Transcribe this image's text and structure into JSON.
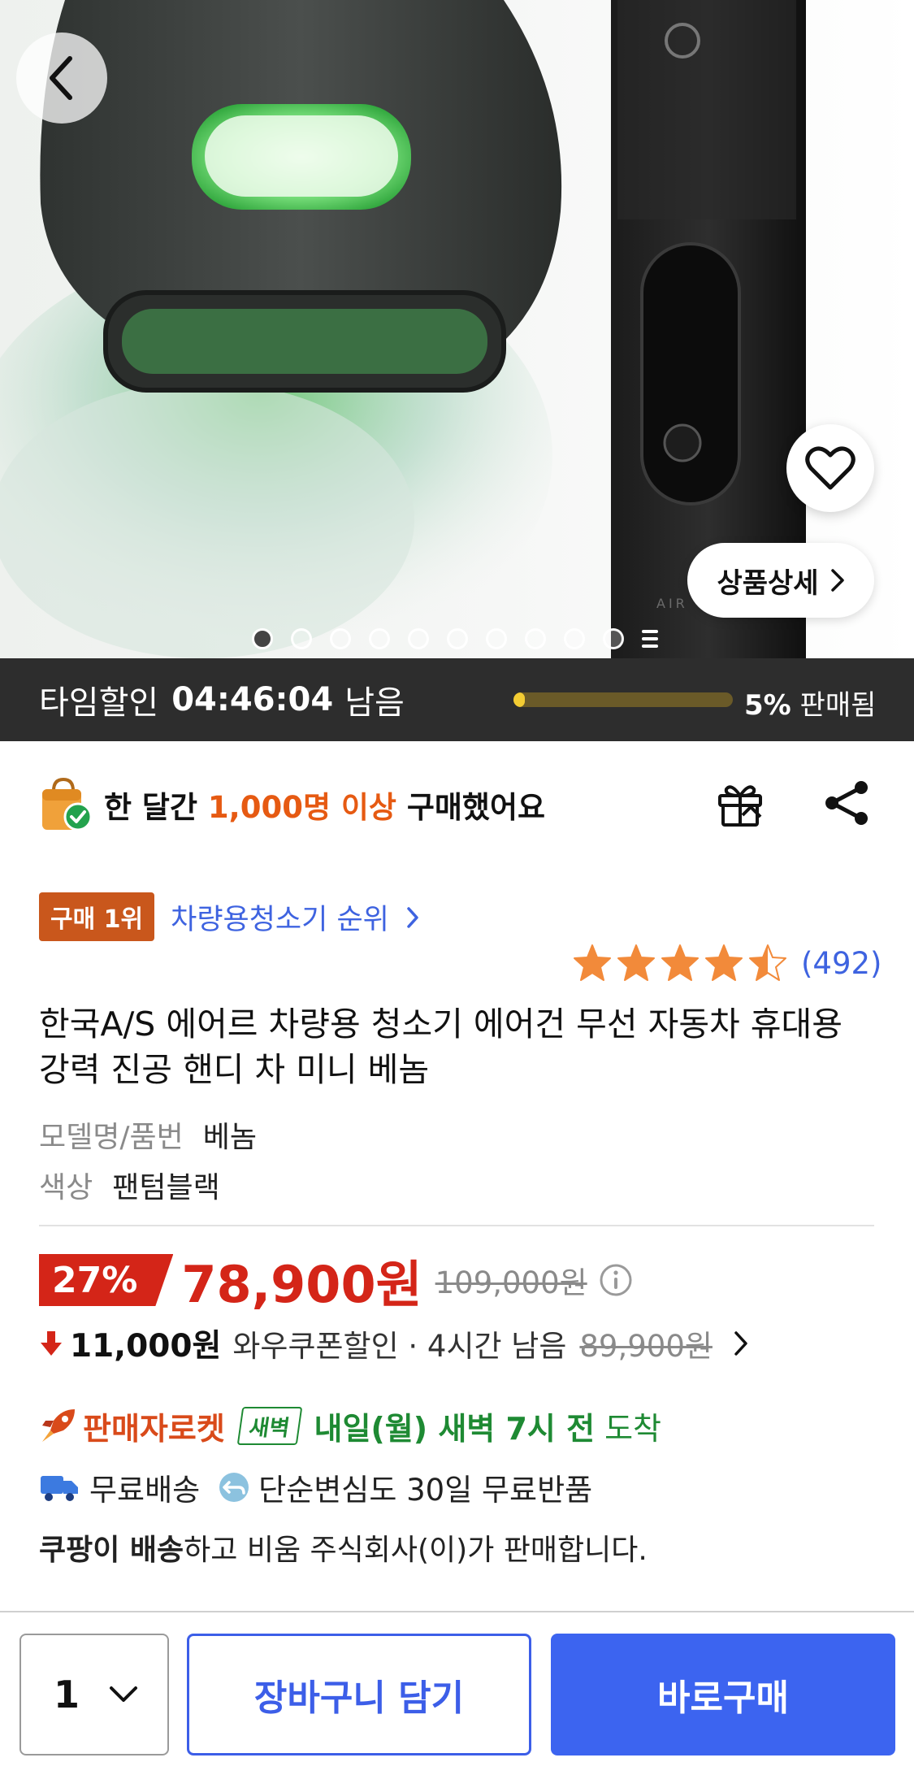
{
  "hero": {
    "product_mark": "AIR",
    "detail_button": "상품상세",
    "slide_count": 10,
    "active_slide": 1
  },
  "timer": {
    "label": "타임할인",
    "time": "04:46:04",
    "suffix": "남음",
    "sold_percent": "5%",
    "sold_label": "판매됨",
    "sold_fraction": 0.05
  },
  "social": {
    "prefix": "한 달간",
    "highlight": "1,000명 이상",
    "suffix": "구매했어요"
  },
  "rank": {
    "badge": "구매 1위",
    "link": "차량용청소기 순위"
  },
  "rating": {
    "stars": 4.5,
    "count": "(492)"
  },
  "product": {
    "title": "한국A/S 에어르 차량용 청소기 에어건 무선 자동차 휴대용 강력 진공 핸디 차 미니 베놈",
    "specs": [
      {
        "key": "모델명/품번",
        "value": "베놈"
      },
      {
        "key": "색상",
        "value": "팬텀블랙"
      }
    ]
  },
  "price": {
    "discount": "27%",
    "sale": "78,900원",
    "original": "109,000원"
  },
  "coupon": {
    "amount": "11,000원",
    "label": "와우쿠폰할인 · 4시간 남음",
    "price": "89,900원"
  },
  "delivery": {
    "brand": "판매자로켓",
    "badge": "새벽",
    "arrival": "내일(월) 새벽 7시 전",
    "arrival_tail": "도착",
    "free_shipping": "무료배송",
    "free_return": "단순변심도 30일 무료반품"
  },
  "seller": {
    "strong": "쿠팡이 배송",
    "rest": "하고 비움 주식회사(이)가 판매합니다."
  },
  "bottom": {
    "quantity": "1",
    "cart": "장바구니 담기",
    "buy": "바로구매"
  },
  "colors": {
    "accent_blue": "#3c64f0",
    "sale_red": "#d42518",
    "rocket_orange": "#d94a1a",
    "dawn_green": "#1e8a33",
    "timer_bg": "#2d2d2d"
  }
}
